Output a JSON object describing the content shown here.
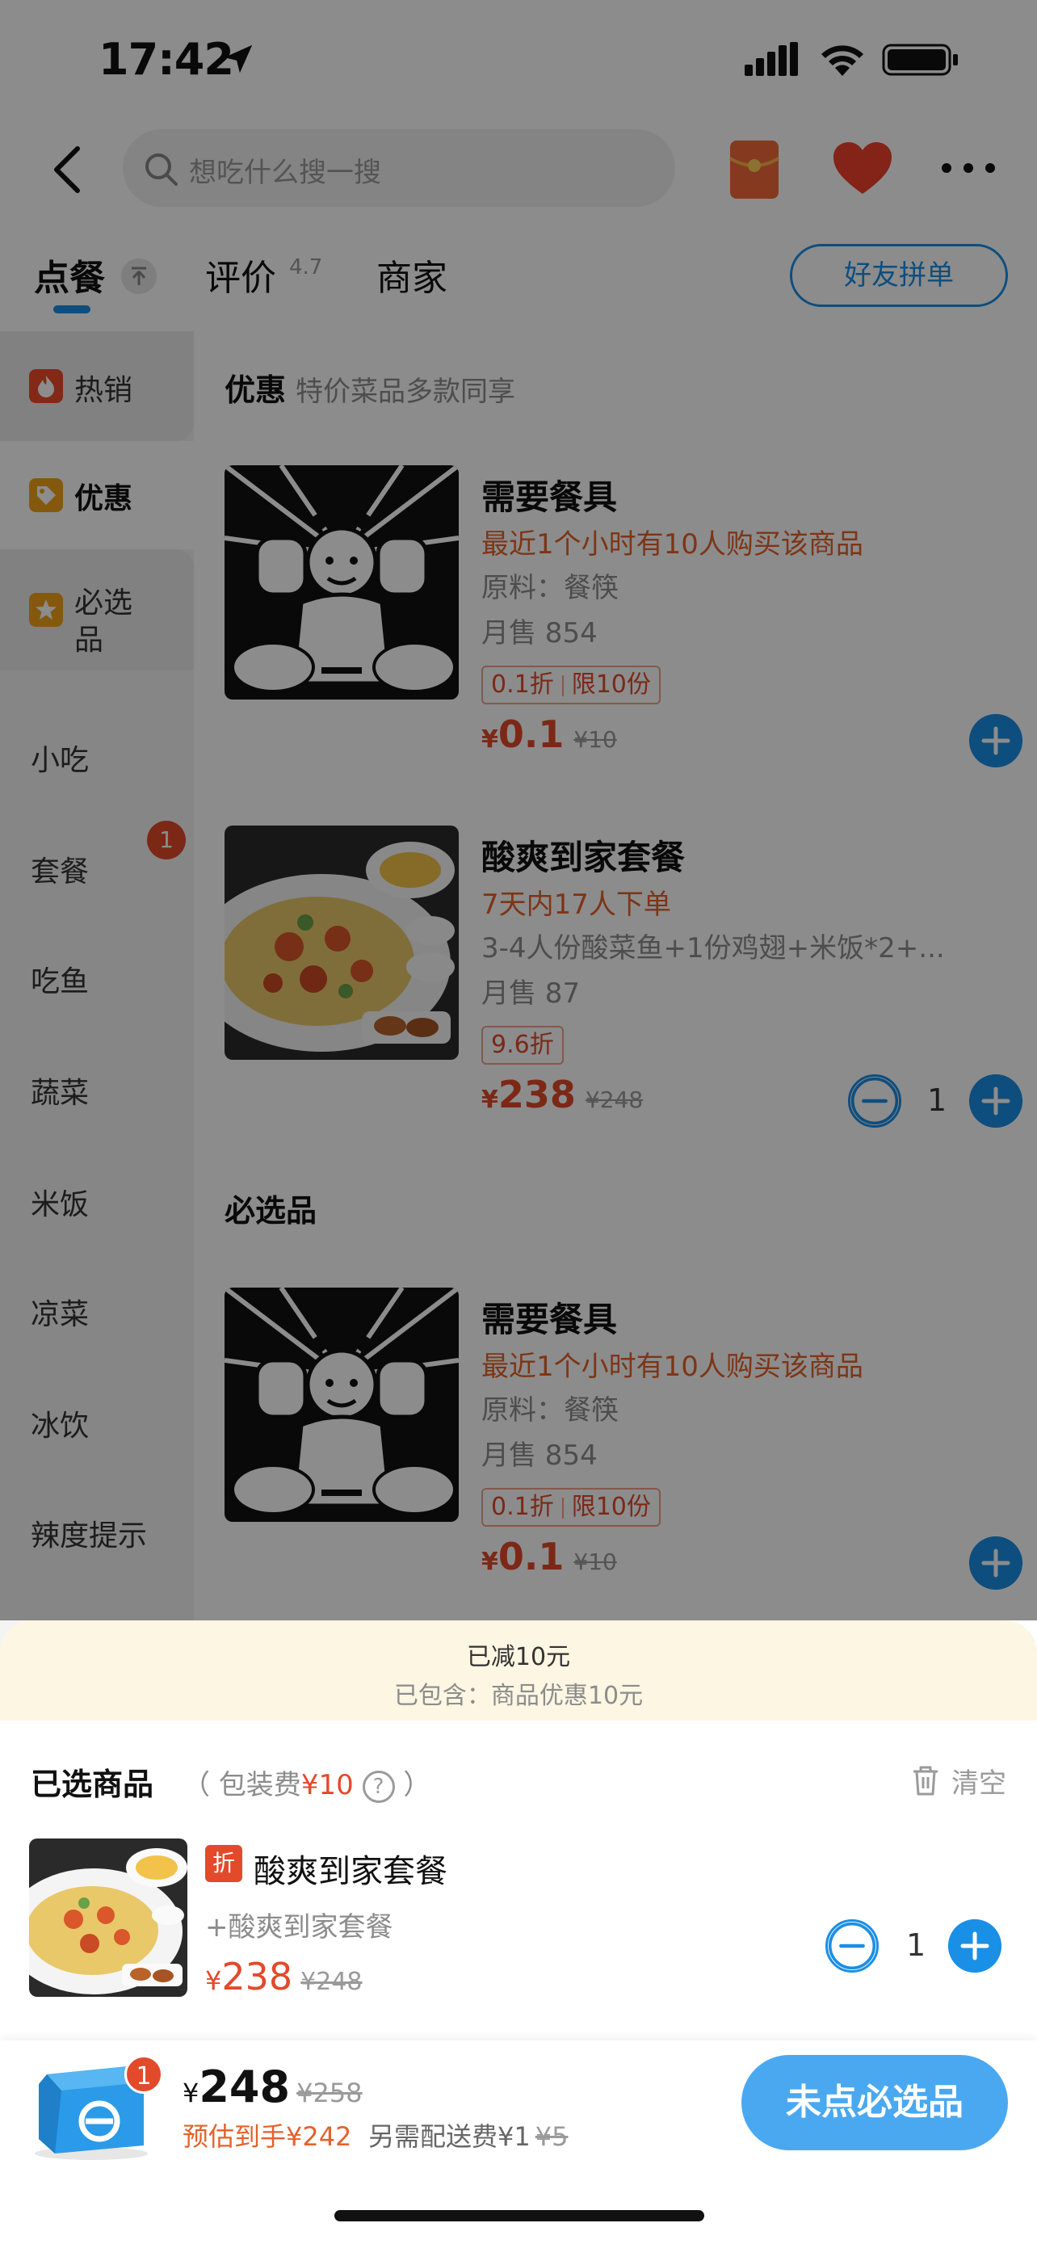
{
  "status": {
    "time": "17:42"
  },
  "header": {
    "search_placeholder": "想吃什么搜一搜"
  },
  "tabs": {
    "order": "点餐",
    "review": "评价",
    "rating": "4.7",
    "merchant": "商家",
    "friend_button": "好友拼单"
  },
  "sidebar": {
    "hot": "热销",
    "discount": "优惠",
    "must": "必选\n品",
    "items": [
      "小吃",
      "套餐",
      "吃鱼",
      "蔬菜",
      "米饭",
      "凉菜",
      "冰饮",
      "辣度提示"
    ],
    "set_badge": "1"
  },
  "section_discount": {
    "title": "优惠",
    "subtitle": "特价菜品多款同享"
  },
  "section_must": {
    "title": "必选品"
  },
  "items": [
    {
      "name": "需要餐具",
      "hot": "最近1个小时有10人购买该商品",
      "desc": "原料：餐筷",
      "sales": "月售 854",
      "tag_discount": "0.1折",
      "tag_limit": "限10份",
      "currency": "¥",
      "price": "0.1",
      "orig_price": "¥10"
    },
    {
      "name": "酸爽到家套餐",
      "hot": "7天内17人下单",
      "desc": "3-4人份酸菜鱼+1份鸡翅+米饭*2+...",
      "sales": "月售 87",
      "tag_discount": "9.6折",
      "currency": "¥",
      "price": "238",
      "orig_price": "¥248",
      "qty": "1"
    },
    {
      "name": "需要餐具",
      "hot": "最近1个小时有10人购买该商品",
      "desc": "原料：餐筷",
      "sales": "月售 854",
      "tag_discount": "0.1折",
      "tag_limit": "限10份",
      "currency": "¥",
      "price": "0.1",
      "orig_price": "¥10"
    }
  ],
  "cart": {
    "saved_line1": "已减10元",
    "saved_line2": "已包含：商品优惠10元",
    "selected_title": "已选商品",
    "pack_open": "（ 包装费",
    "pack_fee": "¥10",
    "pack_close": "）",
    "clear": "清空",
    "item": {
      "tag": "折",
      "name": "酸爽到家套餐",
      "sub": "+酸爽到家套餐",
      "currency": "¥",
      "price": "238",
      "orig_price": "¥248",
      "qty": "1"
    }
  },
  "bottom": {
    "badge": "1",
    "currency": "¥",
    "total": "248",
    "orig_total": "¥258",
    "estimate": "预估到手¥242",
    "delivery": "另需配送费¥1",
    "delivery_orig": "¥5",
    "cta": "未点必选品"
  },
  "colors": {
    "accent": "#1a8fe6",
    "price": "#e24a2a",
    "cta": "#4aa8f0",
    "saved_bg": "#fdf6e3"
  }
}
